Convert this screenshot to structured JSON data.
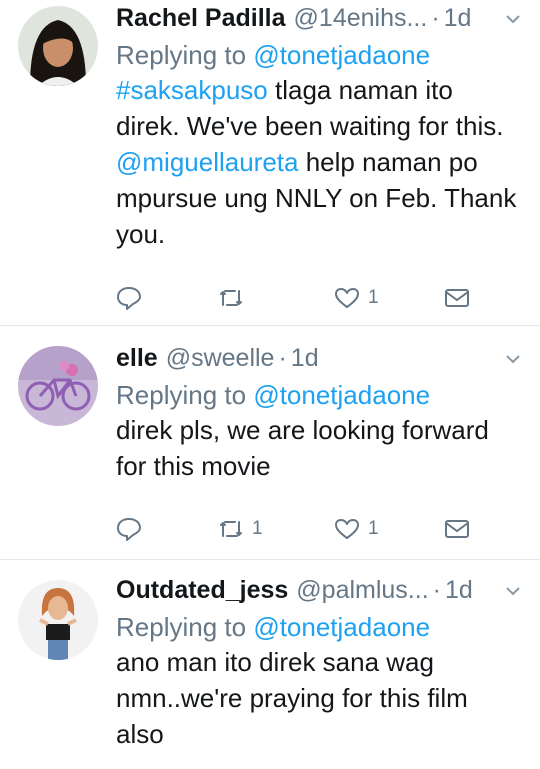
{
  "tweets": [
    {
      "name": "Rachel Padilla",
      "handle": "@14enihs...",
      "time": "1d",
      "replying_prefix": "Replying to",
      "replying_to": "@tonetjadaone",
      "hashtag": "#saksakpuso",
      "text_1": " tlaga naman ito direk. We've been waiting for this.",
      "mention": "@miguellaureta",
      "text_2": " help naman po mpursue ung NNLY on Feb. Thank you.",
      "retweets": "",
      "likes": "1"
    },
    {
      "name": "elle",
      "handle": "@sweelle",
      "time": "1d",
      "replying_prefix": "Replying to",
      "replying_to": "@tonetjadaone",
      "text": "direk pls, we are looking forward for this movie",
      "retweets": "1",
      "likes": "1"
    },
    {
      "name": "Outdated_jess",
      "handle": "@palmlus...",
      "time": "1d",
      "replying_prefix": "Replying to",
      "replying_to": "@tonetjadaone",
      "text": "ano man ito direk sana wag nmn..we're praying for this film also"
    }
  ],
  "colors": {
    "link": "#1da1f2",
    "muted": "#657786",
    "text": "#14171a",
    "divider": "#e1e8ed"
  },
  "icons": [
    "reply-icon",
    "retweet-icon",
    "like-icon",
    "dm-icon",
    "chevron-down-icon"
  ]
}
